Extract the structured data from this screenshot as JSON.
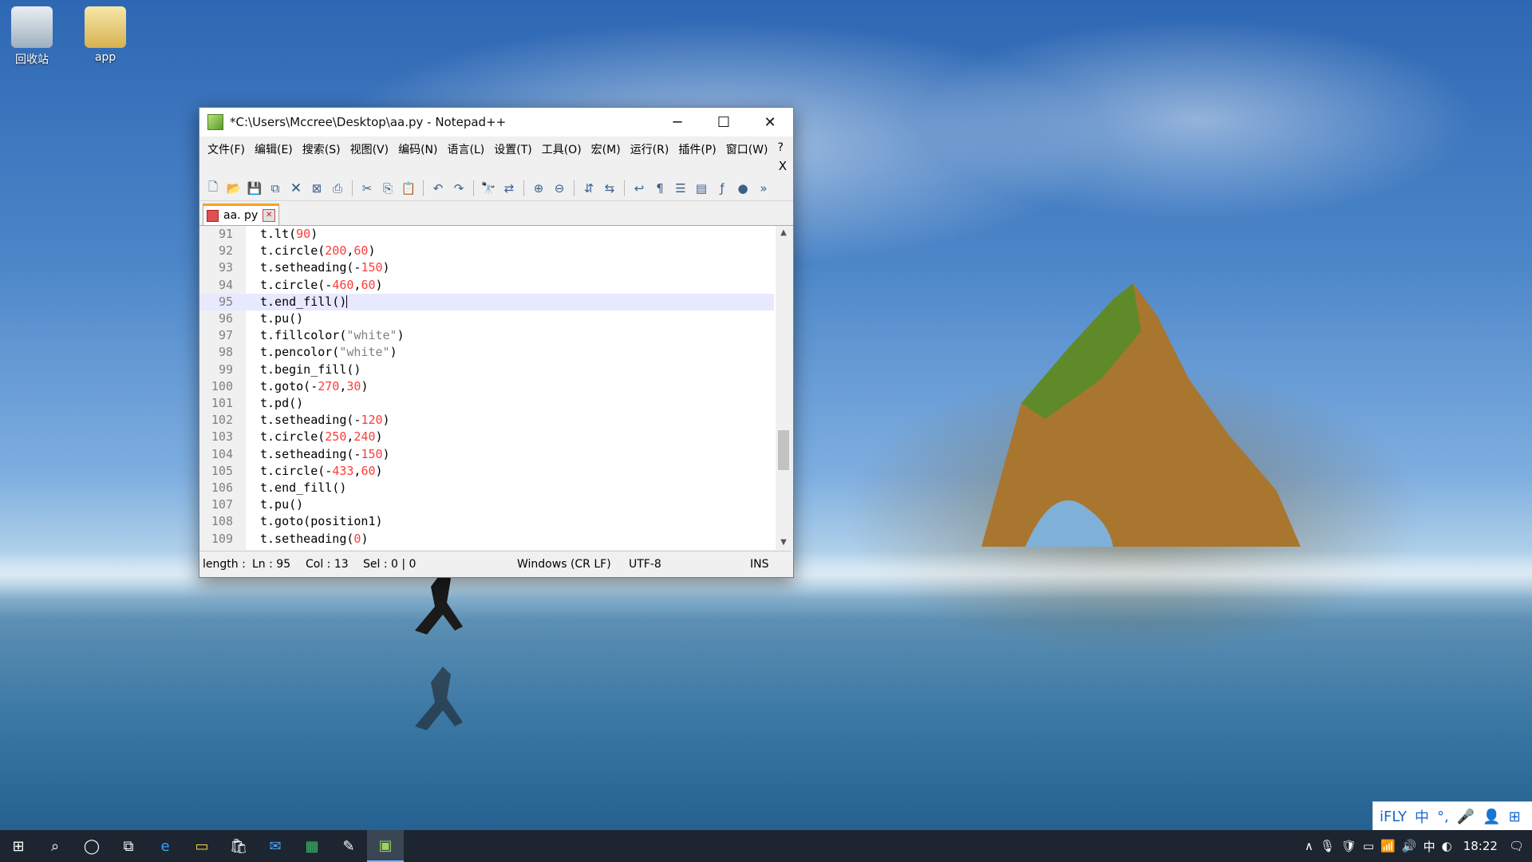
{
  "desktop": {
    "icons": [
      {
        "label": "回收站",
        "icon": "recycle-bin-icon"
      },
      {
        "label": "app",
        "icon": "folder-icon"
      }
    ]
  },
  "window": {
    "title": "*C:\\Users\\Mccree\\Desktop\\aa.py - Notepad++",
    "controls": {
      "minimize": "─",
      "maximize": "☐",
      "close": "✕"
    }
  },
  "menu": {
    "items": [
      "文件(F)",
      "编辑(E)",
      "搜索(S)",
      "视图(V)",
      "编码(N)",
      "语言(L)",
      "设置(T)",
      "工具(O)",
      "宏(M)",
      "运行(R)",
      "插件(P)",
      "窗口(W)",
      "?"
    ],
    "close_label": "X"
  },
  "toolbar": {
    "icons": [
      "new-file-icon",
      "open-file-icon",
      "save-icon",
      "save-all-icon",
      "close-icon",
      "close-all-icon",
      "print-icon",
      "cut-icon",
      "copy-icon",
      "paste-icon",
      "undo-icon",
      "redo-icon",
      "find-icon",
      "replace-icon",
      "zoom-in-icon",
      "zoom-out-icon",
      "sync-vertical-icon",
      "sync-horizontal-icon",
      "word-wrap-icon",
      "show-all-chars-icon",
      "indent-guide-icon",
      "doc-map-icon",
      "function-list-icon",
      "macro-record-icon"
    ],
    "overflow": "»"
  },
  "tab": {
    "label": "aa. py",
    "close": "✕"
  },
  "editor": {
    "current_line": 95,
    "lines": [
      {
        "n": "91",
        "parts": [
          [
            "t.lt(",
            ""
          ],
          [
            "90",
            "num"
          ],
          [
            ")",
            ""
          ]
        ]
      },
      {
        "n": "92",
        "parts": [
          [
            "t.circle(",
            ""
          ],
          [
            "200",
            "num"
          ],
          [
            ",",
            ""
          ],
          [
            "60",
            "num"
          ],
          [
            ")",
            ""
          ]
        ]
      },
      {
        "n": "93",
        "parts": [
          [
            "t.setheading(-",
            ""
          ],
          [
            "150",
            "num"
          ],
          [
            ")",
            ""
          ]
        ]
      },
      {
        "n": "94",
        "parts": [
          [
            "t.circle(-",
            ""
          ],
          [
            "460",
            "num"
          ],
          [
            ",",
            ""
          ],
          [
            "60",
            "num"
          ],
          [
            ")",
            ""
          ]
        ]
      },
      {
        "n": "95",
        "parts": [
          [
            "t.end_fill()",
            ""
          ]
        ]
      },
      {
        "n": "96",
        "parts": [
          [
            "t.pu()",
            ""
          ]
        ]
      },
      {
        "n": "97",
        "parts": [
          [
            "t.fillcolor(",
            ""
          ],
          [
            "\"white\"",
            "str"
          ],
          [
            ")",
            ""
          ]
        ]
      },
      {
        "n": "98",
        "parts": [
          [
            "t.pencolor(",
            ""
          ],
          [
            "\"white\"",
            "str"
          ],
          [
            ")",
            ""
          ]
        ]
      },
      {
        "n": "99",
        "parts": [
          [
            "t.begin_fill()",
            ""
          ]
        ]
      },
      {
        "n": "100",
        "parts": [
          [
            "t.goto(-",
            ""
          ],
          [
            "270",
            "num"
          ],
          [
            ",",
            ""
          ],
          [
            "30",
            "num"
          ],
          [
            ")",
            ""
          ]
        ]
      },
      {
        "n": "101",
        "parts": [
          [
            "t.pd()",
            ""
          ]
        ]
      },
      {
        "n": "102",
        "parts": [
          [
            "t.setheading(-",
            ""
          ],
          [
            "120",
            "num"
          ],
          [
            ")",
            ""
          ]
        ]
      },
      {
        "n": "103",
        "parts": [
          [
            "t.circle(",
            ""
          ],
          [
            "250",
            "num"
          ],
          [
            ",",
            ""
          ],
          [
            "240",
            "num"
          ],
          [
            ")",
            ""
          ]
        ]
      },
      {
        "n": "104",
        "parts": [
          [
            "t.setheading(-",
            ""
          ],
          [
            "150",
            "num"
          ],
          [
            ")",
            ""
          ]
        ]
      },
      {
        "n": "105",
        "parts": [
          [
            "t.circle(-",
            ""
          ],
          [
            "433",
            "num"
          ],
          [
            ",",
            ""
          ],
          [
            "60",
            "num"
          ],
          [
            ")",
            ""
          ]
        ]
      },
      {
        "n": "106",
        "parts": [
          [
            "t.end_fill()",
            ""
          ]
        ]
      },
      {
        "n": "107",
        "parts": [
          [
            "t.pu()",
            ""
          ]
        ]
      },
      {
        "n": "108",
        "parts": [
          [
            "t.goto(position1)",
            ""
          ]
        ]
      },
      {
        "n": "109",
        "parts": [
          [
            "t.setheading(",
            ""
          ],
          [
            "0",
            "num"
          ],
          [
            ")",
            ""
          ]
        ]
      }
    ],
    "scroll": {
      "up": "▲",
      "down": "▼"
    }
  },
  "status": {
    "length": "length : ",
    "ln": "Ln : 95",
    "col": "Col : 13",
    "sel": "Sel : 0 | 0",
    "eol": "Windows (CR LF)",
    "encoding": "UTF-8",
    "mode": "INS"
  },
  "ime": {
    "items": [
      "iFLY",
      "中",
      "°,",
      "🎤",
      "👤",
      "⊞"
    ]
  },
  "taskbar": {
    "apps": [
      "start-icon",
      "search-icon",
      "cortana-icon",
      "task-view-icon",
      "edge-icon",
      "file-explorer-icon",
      "store-icon",
      "mail-icon",
      "excel-icon",
      "notes-icon",
      "notepadpp-icon"
    ],
    "tray": {
      "chevron": "∧",
      "lang": "中",
      "time": "18:22"
    }
  }
}
